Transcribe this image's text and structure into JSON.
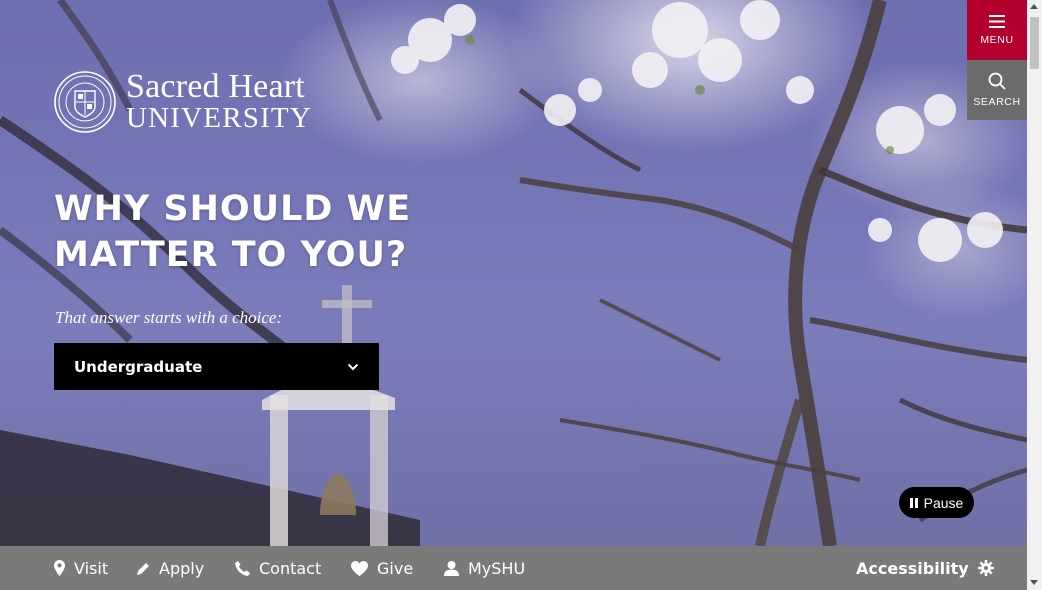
{
  "logo": {
    "line1": "Sacred Heart",
    "line2": "UNIVERSITY"
  },
  "hero": {
    "headline_line1": "WHY SHOULD WE",
    "headline_line2": "MATTER TO YOU?",
    "tagline": "That answer starts with a choice:",
    "selected_option": "Undergraduate",
    "pause_label": "Pause"
  },
  "header": {
    "menu_label": "MENU",
    "search_label": "SEARCH"
  },
  "bottom_nav": {
    "items": [
      {
        "label": "Visit",
        "icon": "map-pin-icon"
      },
      {
        "label": "Apply",
        "icon": "pencil-icon"
      },
      {
        "label": "Contact",
        "icon": "phone-icon"
      },
      {
        "label": "Give",
        "icon": "heart-icon"
      },
      {
        "label": "MySHU",
        "icon": "user-icon"
      }
    ],
    "accessibility_label": "Accessibility"
  },
  "colors": {
    "menu_bg": "#b3002f",
    "search_bg": "#6b6b6b",
    "bottom_bar_bg": "#7a7a7a",
    "select_bg": "#000000"
  }
}
